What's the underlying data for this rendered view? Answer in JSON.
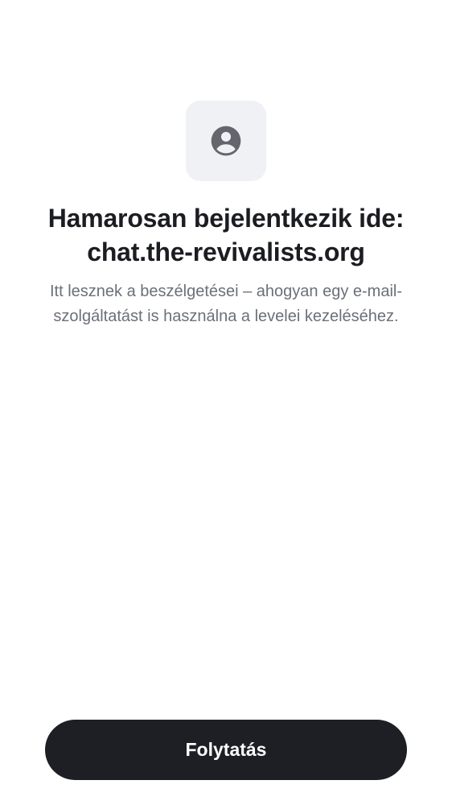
{
  "icon": {
    "name": "account-circle-icon",
    "tile_color": "#f0f1f5",
    "glyph_color": "#63666d"
  },
  "headline": {
    "line1": "Hamarosan bejelentkezik ide:",
    "line2": "chat.the-revivalists.org"
  },
  "subtitle": "Itt lesznek a beszélgetései – ahogyan egy e-mail-szolgáltatást is használna a levelei kezeléséhez.",
  "actions": {
    "continue_label": "Folytatás",
    "button_color": "#1e1f24"
  }
}
